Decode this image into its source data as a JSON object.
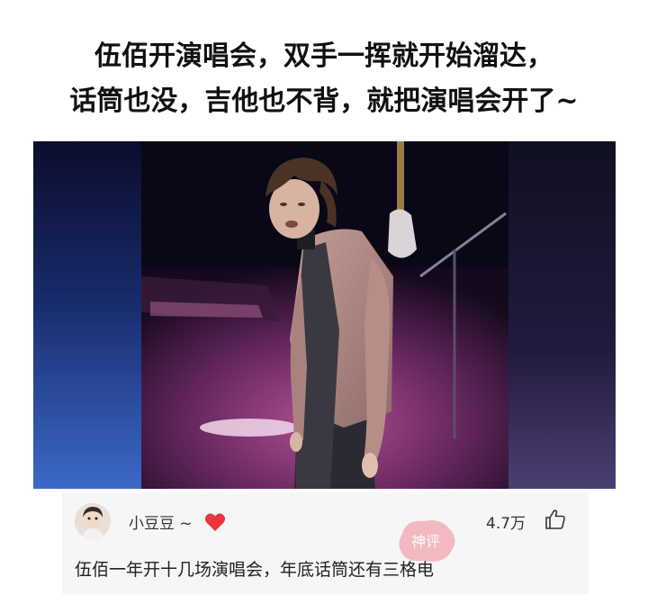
{
  "post": {
    "headline_line1": "伍佰开演唱会，双手一挥就开始溜达，",
    "headline_line2": "话筒也没，吉他也不背，就把演唱会开了~"
  },
  "video": {
    "description_icon": "concert-performer-image"
  },
  "comment": {
    "username": "小豆豆 ~",
    "likes": "4.7万",
    "text": "伍佰一年开十几场演唱会，年底话筒还有三格电",
    "badge": "神评"
  },
  "colors": {
    "heart": "#e8363b",
    "badge": "#f08a94",
    "card_bg": "#f6f6f6"
  }
}
